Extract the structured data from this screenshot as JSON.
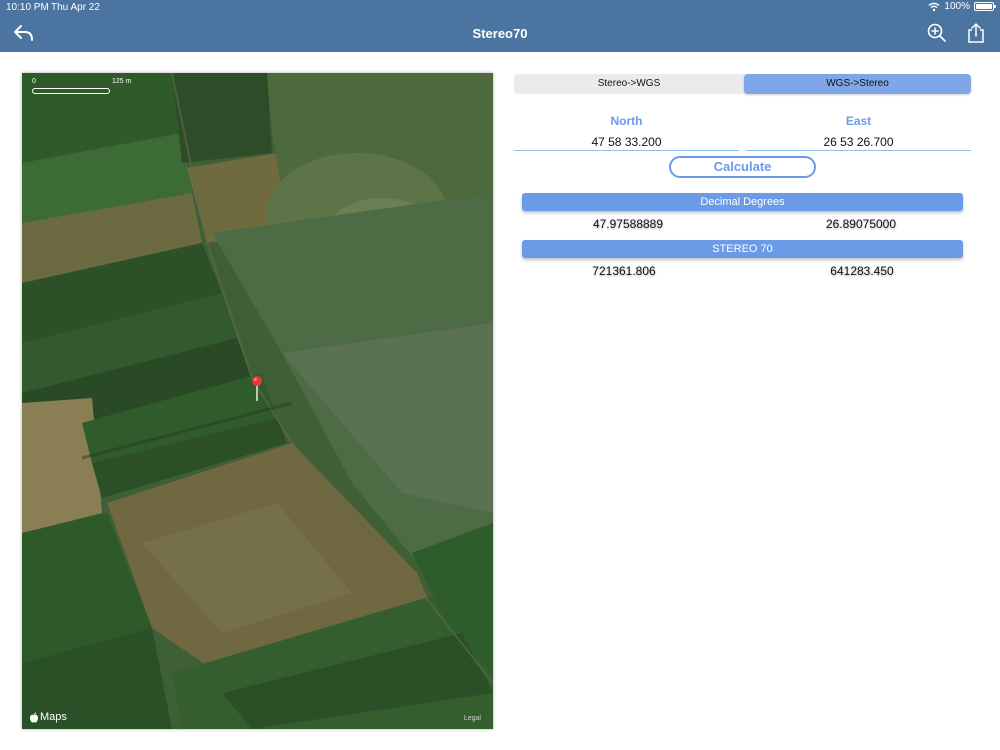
{
  "status": {
    "time": "10:10 PM",
    "date": "Thu Apr 22",
    "battery": "100%"
  },
  "nav": {
    "title": "Stereo70"
  },
  "icons": {
    "back": "reply-icon",
    "zoom": "zoom-in-icon",
    "share": "share-icon"
  },
  "map": {
    "scale_zero": "0",
    "scale_distance": "125 m",
    "logo_text": "Maps",
    "legal": "Legal"
  },
  "segment": {
    "option1": "Stereo->WGS",
    "option2": "WGS->Stereo",
    "selected": "WGS->Stereo"
  },
  "inputs": {
    "north_label": "North",
    "east_label": "East",
    "north_value": "47 58 33.200",
    "east_value": "26 53 26.700"
  },
  "calculate_label": "Calculate",
  "results": {
    "decimal_header": "Decimal Degrees",
    "decimal_north": "47.97588889",
    "decimal_east": "26.89075000",
    "stereo_header": "STEREO 70",
    "stereo_north": "721361.806",
    "stereo_east": "641283.450"
  },
  "colors": {
    "nav": "#4b75a0",
    "accent": "#6b9be6",
    "segment_selected": "#7fa7e8"
  }
}
